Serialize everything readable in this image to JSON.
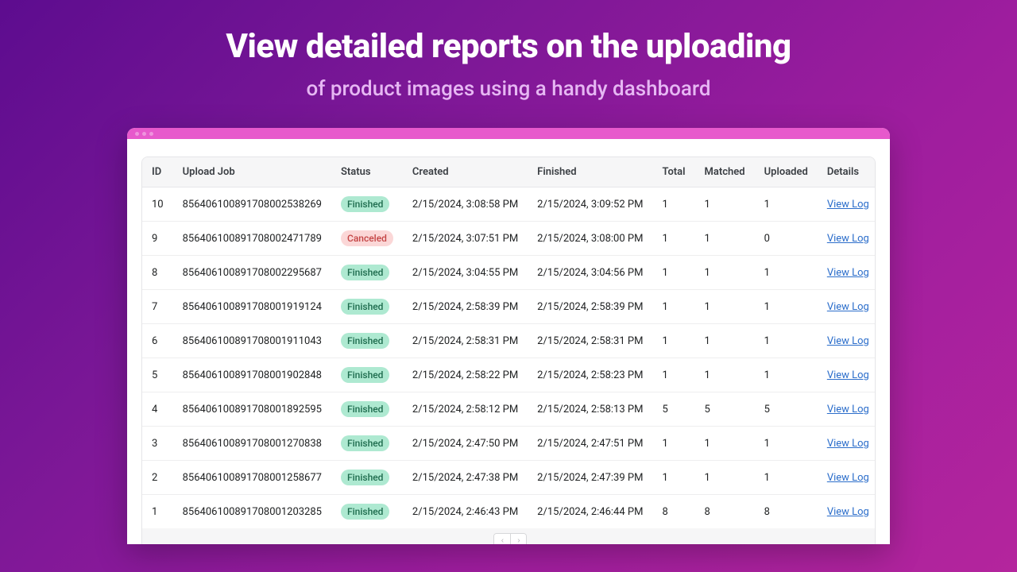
{
  "headline": "View detailed reports on the uploading",
  "subhead": "of product images using a handy dashboard",
  "statusColors": {
    "Finished": "badge-finished",
    "Canceled": "badge-canceled"
  },
  "table": {
    "headers": {
      "id": "ID",
      "job": "Upload Job",
      "status": "Status",
      "created": "Created",
      "finished": "Finished",
      "total": "Total",
      "matched": "Matched",
      "uploaded": "Uploaded",
      "details": "Details"
    },
    "details_link_label": "View Log",
    "rows": [
      {
        "id": "10",
        "job": "856406100891708002538269",
        "status": "Finished",
        "created": "2/15/2024, 3:08:58 PM",
        "finished": "2/15/2024, 3:09:52 PM",
        "total": "1",
        "matched": "1",
        "uploaded": "1"
      },
      {
        "id": "9",
        "job": "856406100891708002471789",
        "status": "Canceled",
        "created": "2/15/2024, 3:07:51 PM",
        "finished": "2/15/2024, 3:08:00 PM",
        "total": "1",
        "matched": "1",
        "uploaded": "0"
      },
      {
        "id": "8",
        "job": "856406100891708002295687",
        "status": "Finished",
        "created": "2/15/2024, 3:04:55 PM",
        "finished": "2/15/2024, 3:04:56 PM",
        "total": "1",
        "matched": "1",
        "uploaded": "1"
      },
      {
        "id": "7",
        "job": "856406100891708001919124",
        "status": "Finished",
        "created": "2/15/2024, 2:58:39 PM",
        "finished": "2/15/2024, 2:58:39 PM",
        "total": "1",
        "matched": "1",
        "uploaded": "1"
      },
      {
        "id": "6",
        "job": "856406100891708001911043",
        "status": "Finished",
        "created": "2/15/2024, 2:58:31 PM",
        "finished": "2/15/2024, 2:58:31 PM",
        "total": "1",
        "matched": "1",
        "uploaded": "1"
      },
      {
        "id": "5",
        "job": "856406100891708001902848",
        "status": "Finished",
        "created": "2/15/2024, 2:58:22 PM",
        "finished": "2/15/2024, 2:58:23 PM",
        "total": "1",
        "matched": "1",
        "uploaded": "1"
      },
      {
        "id": "4",
        "job": "856406100891708001892595",
        "status": "Finished",
        "created": "2/15/2024, 2:58:12 PM",
        "finished": "2/15/2024, 2:58:13 PM",
        "total": "5",
        "matched": "5",
        "uploaded": "5"
      },
      {
        "id": "3",
        "job": "856406100891708001270838",
        "status": "Finished",
        "created": "2/15/2024, 2:47:50 PM",
        "finished": "2/15/2024, 2:47:51 PM",
        "total": "1",
        "matched": "1",
        "uploaded": "1"
      },
      {
        "id": "2",
        "job": "856406100891708001258677",
        "status": "Finished",
        "created": "2/15/2024, 2:47:38 PM",
        "finished": "2/15/2024, 2:47:39 PM",
        "total": "1",
        "matched": "1",
        "uploaded": "1"
      },
      {
        "id": "1",
        "job": "856406100891708001203285",
        "status": "Finished",
        "created": "2/15/2024, 2:46:43 PM",
        "finished": "2/15/2024, 2:46:44 PM",
        "total": "8",
        "matched": "8",
        "uploaded": "8"
      }
    ]
  },
  "pager": {
    "prev_icon": "‹",
    "next_icon": "›"
  }
}
